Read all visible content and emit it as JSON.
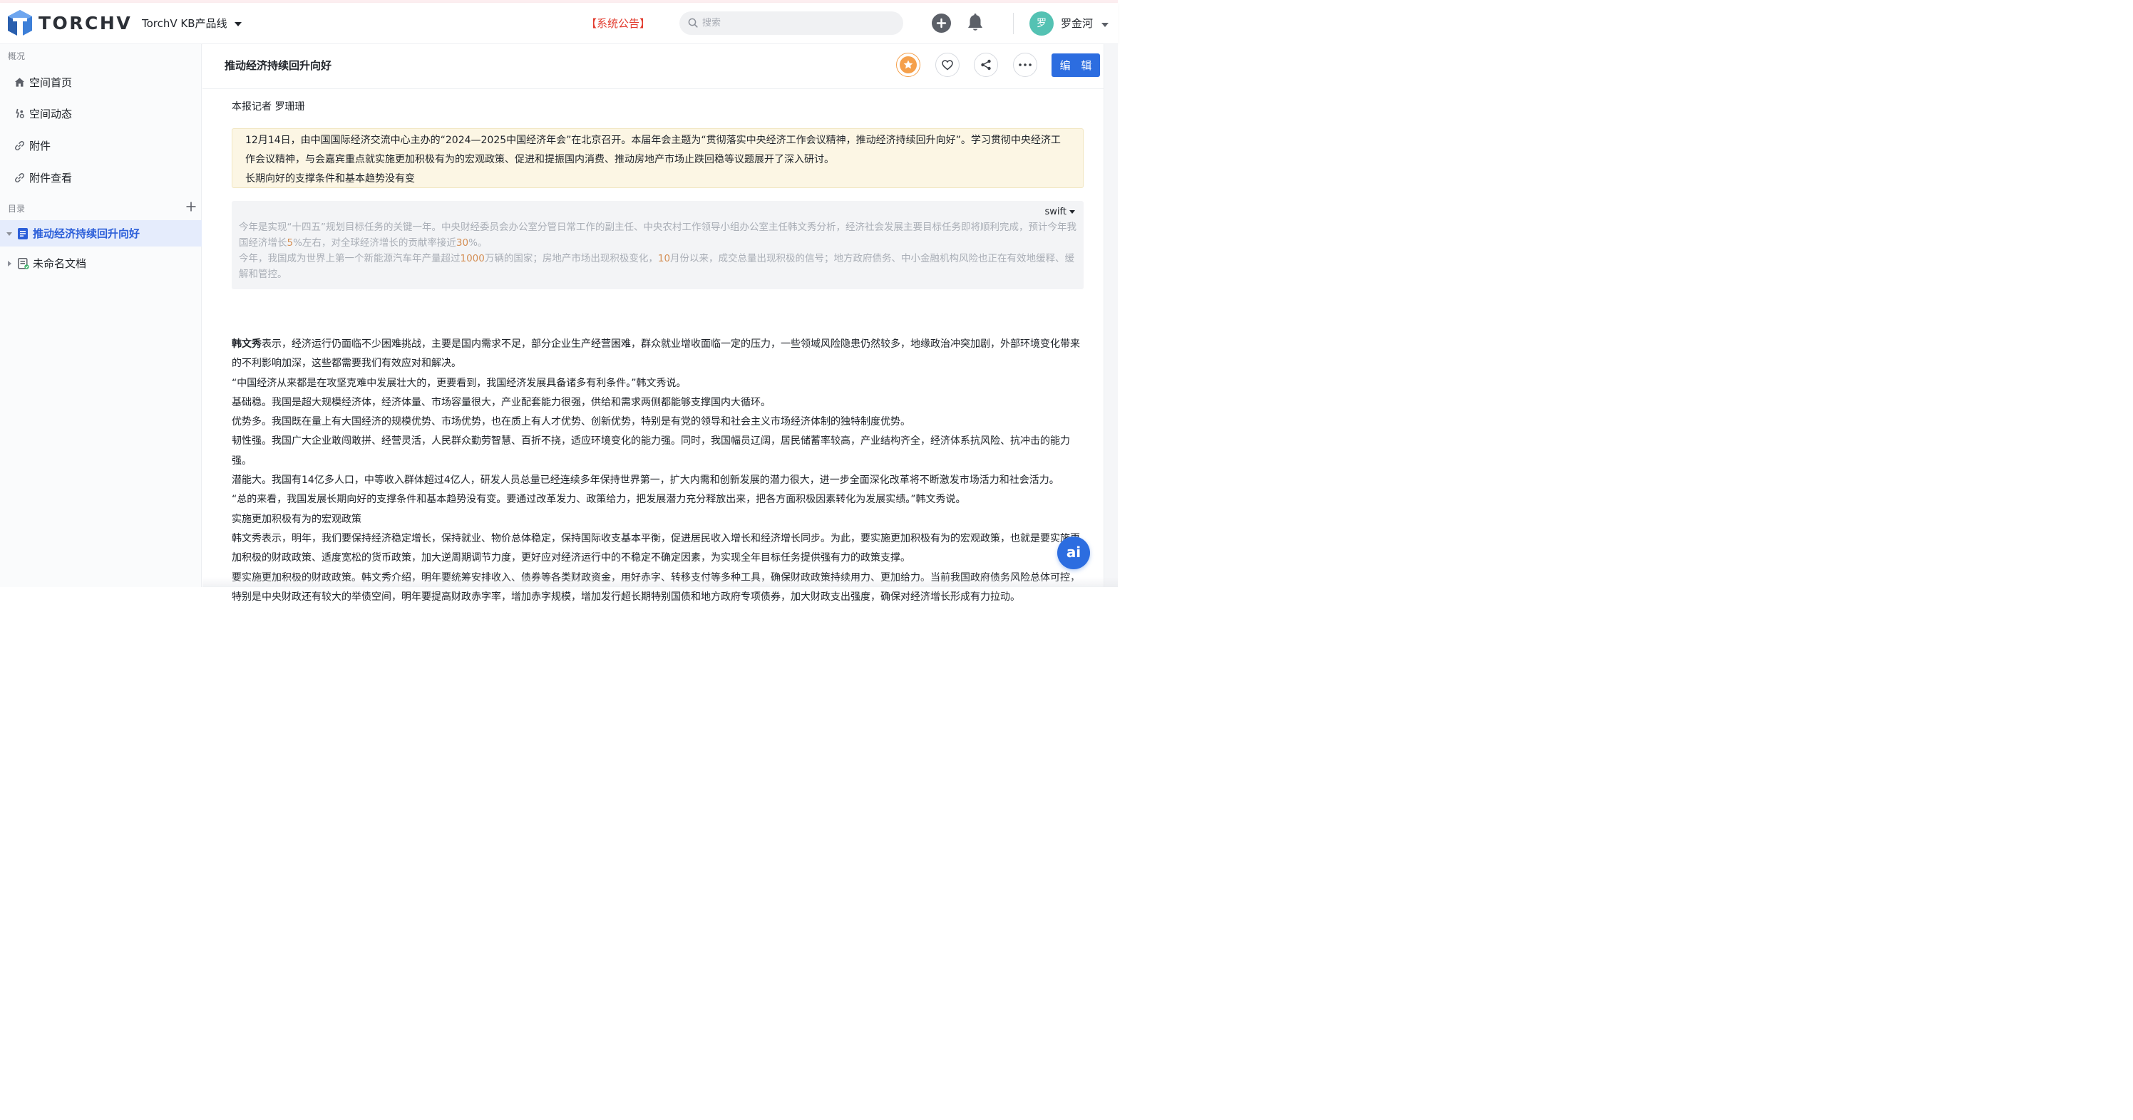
{
  "header": {
    "brand": "TORCHV",
    "product": "TorchV KB产品线",
    "announcement": "【系统公告】",
    "search_placeholder": "搜索",
    "avatar_initial": "罗",
    "user_name": "罗金河"
  },
  "sidebar": {
    "overview_label": "概况",
    "nav": [
      {
        "label": "空间首页",
        "icon": "home-icon"
      },
      {
        "label": "空间动态",
        "icon": "activity-icon"
      },
      {
        "label": "附件",
        "icon": "link-icon"
      },
      {
        "label": "附件查看",
        "icon": "link-icon"
      }
    ],
    "toc_label": "目录",
    "toc": [
      {
        "label": "推动经济持续回升向好",
        "active": true
      },
      {
        "label": "未命名文档",
        "active": false
      }
    ]
  },
  "document": {
    "title": "推动经济持续回升向好",
    "edit_label": "编 辑",
    "reporter": "本报记者 罗珊珊",
    "callout": [
      "12月14日，由中国国际经济交流中心主办的“2024—2025中国经济年会”在北京召开。本届年会主题为“贯彻落实中央经济工作会议精神，推动经济持续回升向好”。学习贯彻中央经济工作会议精神，与会嘉宾重点就实施更加积极有为的宏观政策、促进和提振国内消费、推动房地产市场止跌回稳等议题展开了深入研讨。",
      "长期向好的支撑条件和基本趋势没有变"
    ],
    "code_language": "swift",
    "code_lines": [
      {
        "a": "今年是实现“十四五”规划目标任务的关键一年。中央财经委员会办公室分管日常工作的副主任、中央农村工作领导小组办公室主任韩文秀分析，经济社会发展主要目标任务即将顺利完成，预计今年我国经济增长",
        "n1": "5",
        "b": "%左右，对全球经济增长的贡献率接近",
        "n2": "30",
        "c": "%。"
      },
      {
        "a": "今年，我国成为世界上第一个新能源汽车年产量超过",
        "n1": "1000",
        "b": "万辆的国家；房地产市场出现积极变化，",
        "n2": "10",
        "c": "月份以来，成交总量出现积极的信号；地方政府债务、中小金融机构风险也正在有效地缓释、缓解和管控。"
      }
    ],
    "first_para_bold": "韩文秀",
    "first_para_rest": "表示，经济运行仍面临不少困难挑战，主要是国内需求不足，部分企业生产经营困难，群众就业增收面临一定的压力，一些领域风险隐患仍然较多，地缘政治冲突加剧，外部环境变化带来的不利影响加深，这些都需要我们有效应对和解决。",
    "paragraphs": [
      "“中国经济从来都是在攻坚克难中发展壮大的，更要看到，我国经济发展具备诸多有利条件。”韩文秀说。",
      "基础稳。我国是超大规模经济体，经济体量、市场容量很大，产业配套能力很强，供给和需求两侧都能够支撑国内大循环。",
      "优势多。我国既在量上有大国经济的规模优势、市场优势，也在质上有人才优势、创新优势，特别是有党的领导和社会主义市场经济体制的独特制度优势。",
      "韧性强。我国广大企业敢闯敢拼、经营灵活，人民群众勤劳智慧、百折不挠，适应环境变化的能力强。同时，我国幅员辽阔，居民储蓄率较高，产业结构齐全，经济体系抗风险、抗冲击的能力强。",
      "潜能大。我国有14亿多人口，中等收入群体超过4亿人，研发人员总量已经连续多年保持世界第一，扩大内需和创新发展的潜力很大，进一步全面深化改革将不断激发市场活力和社会活力。",
      "“总的来看，我国发展长期向好的支撑条件和基本趋势没有变。要通过改革发力、政策给力，把发展潜力充分释放出来，把各方面积极因素转化为发展实绩。”韩文秀说。",
      "实施更加积极有为的宏观政策",
      "韩文秀表示，明年，我们要保持经济稳定增长，保持就业、物价总体稳定，保持国际收支基本平衡，促进居民收入增长和经济增长同步。为此，要实施更加积极有为的宏观政策，也就是要实施更加积极的财政政策、适度宽松的货币政策，加大逆周期调节力度，更好应对经济运行中的不稳定不确定因素，为实现全年目标任务提供强有力的政策支撑。",
      "要实施更加积极的财政政策。韩文秀介绍，明年要统筹安排收入、债券等各类财政资金，用好赤字、转移支付等多种工具，确保财政政策持续用力、更加给力。当前我国政府债务风险总体可控，特别是中央财政还有较大的举债空间，明年要提高财政赤字率，增加赤字规模，增加发行超长期特别国债和地方政府专项债券，加大财政支出强度，确保对经济增长形成有力拉动。"
    ]
  },
  "ai_button_label": "ai",
  "colors": {
    "accent": "#2c6de0",
    "announcement": "#e23b2e",
    "callout_bg": "#fcf6e4",
    "favorite": "#f5a04b",
    "avatar": "#54c2b3"
  }
}
